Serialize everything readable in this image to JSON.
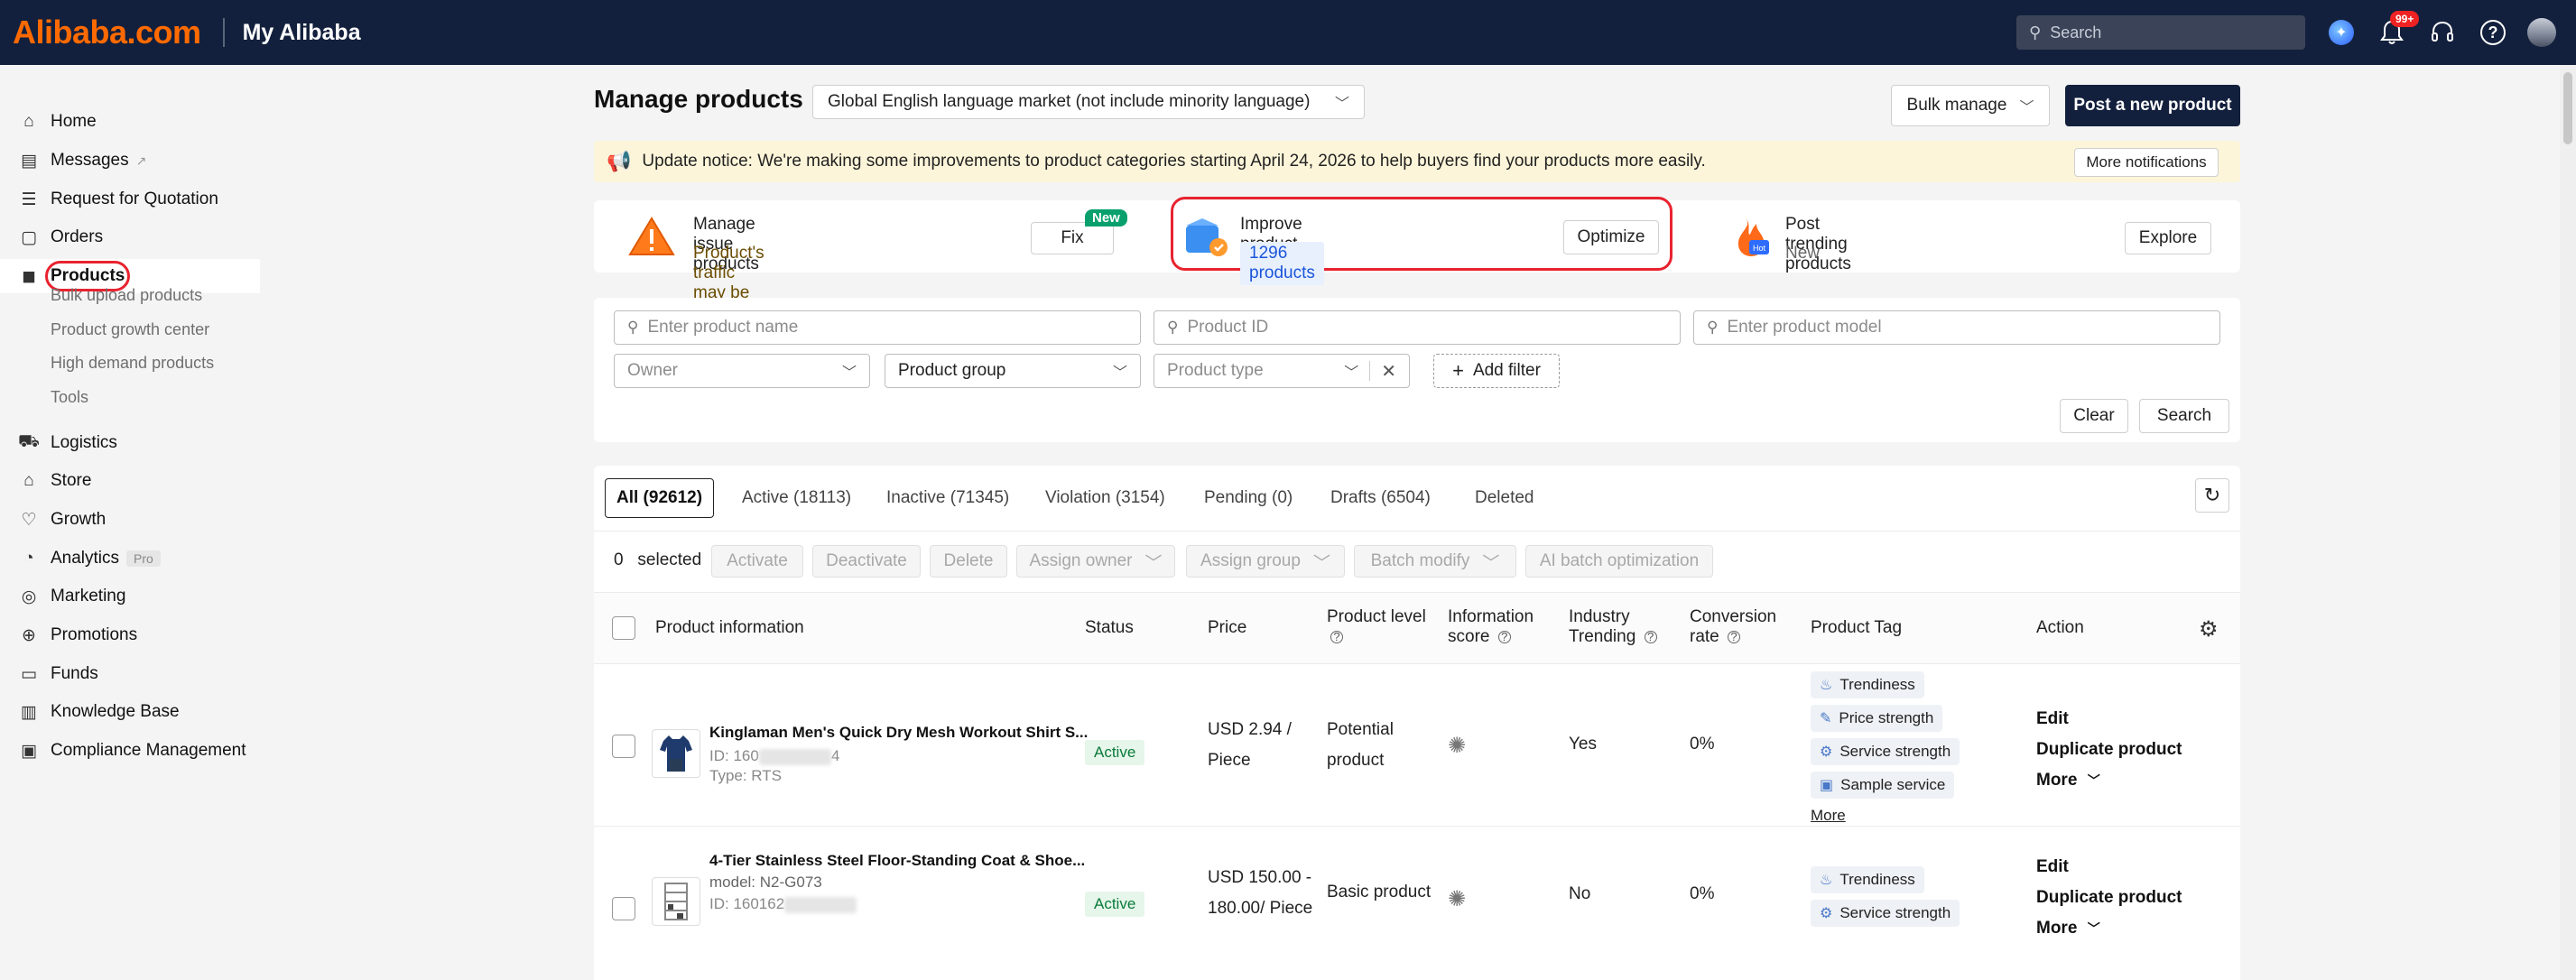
{
  "topbar": {
    "logo_text": "Alibaba.com",
    "app_title": "My Alibaba",
    "search_placeholder": "Search",
    "notification_count": "99+"
  },
  "sidebar": {
    "items": [
      {
        "label": "Home",
        "icon": "home-icon"
      },
      {
        "label": "Messages",
        "icon": "message-icon",
        "extra": "↗"
      },
      {
        "label": "Request for Quotation",
        "icon": "rfq-icon"
      },
      {
        "label": "Orders",
        "icon": "orders-icon"
      },
      {
        "label": "Products",
        "icon": "cube-icon"
      },
      {
        "label": "Logistics",
        "icon": "logistics-icon"
      },
      {
        "label": "Store",
        "icon": "store-icon"
      },
      {
        "label": "Growth",
        "icon": "growth-icon"
      },
      {
        "label": "Analytics",
        "icon": "analytics-icon",
        "badge": "Pro"
      },
      {
        "label": "Marketing",
        "icon": "marketing-icon"
      },
      {
        "label": "Promotions",
        "icon": "promotions-icon"
      },
      {
        "label": "Funds",
        "icon": "funds-icon"
      },
      {
        "label": "Knowledge Base",
        "icon": "knowledge-icon"
      },
      {
        "label": "Compliance Management",
        "icon": "compliance-icon"
      }
    ],
    "products_sub": [
      "Bulk upload products",
      "Product growth center",
      "High demand products",
      "Tools"
    ]
  },
  "page": {
    "title": "Manage products",
    "language_market": "Global English language market  (not include minority language)",
    "bulk_manage": "Bulk manage",
    "post_new": "Post a new product"
  },
  "notice": {
    "text": "Update notice: We're making some improvements to product categories starting April 24, 2026 to help buyers find your products more easily.",
    "more_button": "More notifications"
  },
  "cards": {
    "issue": {
      "title": "Manage issue products",
      "sub": "Product's traffic may be affected",
      "button": "Fix",
      "badge": "New"
    },
    "quality": {
      "title": "Improve product quality",
      "sub": "1296 products",
      "button": "Optimize"
    },
    "trending": {
      "title": "Post trending products",
      "sub": "New",
      "button": "Explore"
    }
  },
  "filters": {
    "product_name_placeholder": "Enter product name",
    "product_id_placeholder": "Product ID",
    "product_model_placeholder": "Enter product model",
    "owner_placeholder": "Owner",
    "group_placeholder": "Product group",
    "type_placeholder": "Product type",
    "add_filter": "Add filter",
    "clear": "Clear",
    "search": "Search"
  },
  "tabs": [
    {
      "label": "All (92612)"
    },
    {
      "label": "Active (18113)"
    },
    {
      "label": "Inactive (71345)"
    },
    {
      "label": "Violation (3154)"
    },
    {
      "label": "Pending (0)"
    },
    {
      "label": "Drafts (6504)"
    },
    {
      "label": "Deleted"
    }
  ],
  "bulk_actions": {
    "selected_count": "0",
    "selected_label": "selected",
    "activate": "Activate",
    "deactivate": "Deactivate",
    "delete": "Delete",
    "assign_owner": "Assign owner",
    "assign_group": "Assign group",
    "batch_modify": "Batch modify",
    "ai_batch": "AI batch optimization"
  },
  "table": {
    "headers": {
      "product_info": "Product information",
      "status": "Status",
      "price": "Price",
      "level_line1": "Product level",
      "score_line1": "Information",
      "score_line2": "score",
      "trending_line1": "Industry",
      "trending_line2": "Trending",
      "conversion_line1": "Conversion",
      "conversion_line2": "rate",
      "tag": "Product Tag",
      "action": "Action"
    },
    "rows": [
      {
        "name": "Kinglaman Men's Quick Dry Mesh Workout Shirt S...",
        "id_prefix": "ID: 160",
        "id_suffix": "4",
        "type": "Type: RTS",
        "status": "Active",
        "price_line1": "USD 2.94 /",
        "price_line2": "Piece",
        "level_line1": "Potential",
        "level_line2": "product",
        "trending": "Yes",
        "conversion": "0%",
        "tags": [
          "Trendiness",
          "Price strength",
          "Service strength",
          "Sample service"
        ],
        "more": "More",
        "edit": "Edit",
        "duplicate": "Duplicate product",
        "more_action": "More"
      },
      {
        "name": "4-Tier Stainless Steel Floor-Standing Coat & Shoe...",
        "model": "model: N2-G073",
        "id_prefix": "ID: 160162",
        "status": "Active",
        "price_line1": "USD 150.00 -",
        "price_line2": "180.00/ Piece",
        "level_line1": "Basic product",
        "trending": "No",
        "conversion": "0%",
        "tags": [
          "Trendiness",
          "Service strength"
        ],
        "edit": "Edit",
        "duplicate": "Duplicate product",
        "more_action": "More"
      }
    ]
  }
}
